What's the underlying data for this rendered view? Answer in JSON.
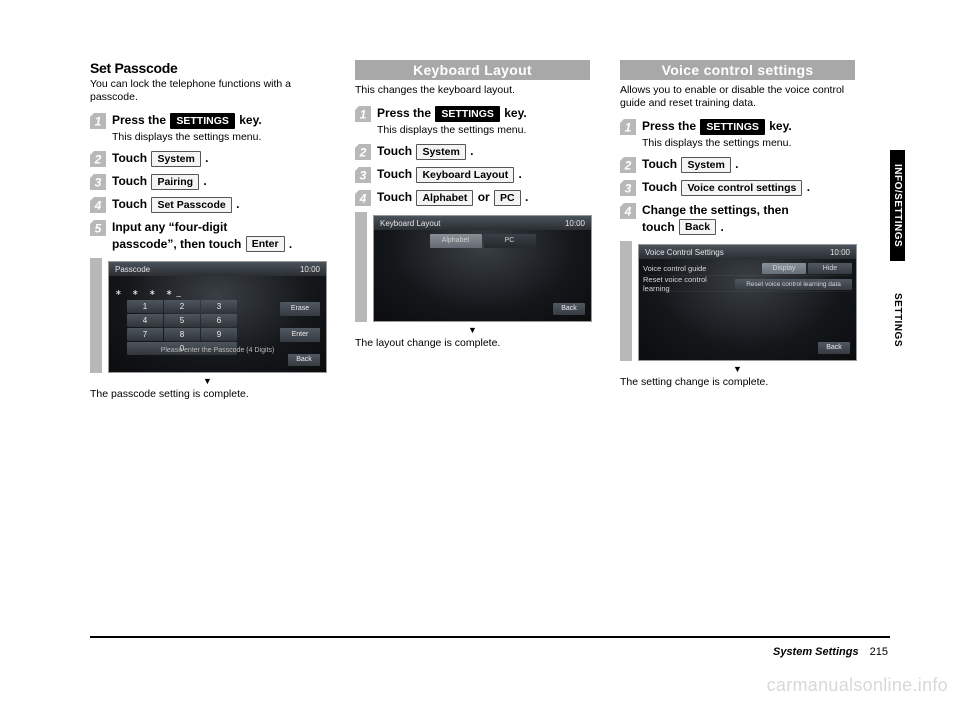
{
  "col1": {
    "title": "Set Passcode",
    "sub": "You can lock the telephone functions with a passcode.",
    "step1_pre": "Press the ",
    "settings_btn": "SETTINGS",
    "step1_post": " key.",
    "step1_note": "This displays the settings menu.",
    "step2_pre": "Touch ",
    "system_btn": "System",
    "dot": " .",
    "step3_pre": "Touch ",
    "pairing_btn": "Pairing",
    "step4_pre": "Touch ",
    "setpass_btn": "Set Passcode",
    "step5_line1": "Input any “four-digit",
    "step5_line2_pre": "passcode”, then touch ",
    "enter_btn": "Enter",
    "ss_title": "Passcode",
    "ss_clock": "10:00",
    "ss_stars": "∗ ∗ ∗ ∗_",
    "ss_erase": "Erase",
    "ss_enter": "Enter",
    "ss_back": "Back",
    "ss_keys": {
      "k1": "1",
      "k2": "2",
      "k3": "3",
      "k4": "4",
      "k5": "5",
      "k6": "6",
      "k7": "7",
      "k8": "8",
      "k9": "9",
      "k0": "0"
    },
    "ss_footer": "Please enter the Passcode (4 Digits)",
    "caret": "▼",
    "final": "The passcode setting is complete."
  },
  "col2": {
    "header": "Keyboard Layout",
    "sub": "This changes the keyboard layout.",
    "step1_pre": "Press the ",
    "settings_btn": "SETTINGS",
    "step1_post": " key.",
    "step1_note": "This displays the settings menu.",
    "step2_pre": "Touch ",
    "system_btn": "System",
    "dot": " .",
    "step3_pre": "Touch ",
    "kblayout_btn": "Keyboard Layout",
    "step4_pre": "Touch ",
    "alpha_btn": "Alphabet",
    "step4_mid": " or ",
    "pc_btn": "PC",
    "ss_title": "Keyboard Layout",
    "ss_clock": "10:00",
    "ss_alpha": "Alphabet",
    "ss_pc": "PC",
    "ss_back": "Back",
    "caret": "▼",
    "final": "The layout change is complete."
  },
  "col3": {
    "header": "Voice control settings",
    "sub": "Allows you to enable or disable the voice control guide and reset training data.",
    "step1_pre": "Press the ",
    "settings_btn": "SETTINGS",
    "step1_post": " key.",
    "step1_note": "This displays the settings menu.",
    "step2_pre": "Touch ",
    "system_btn": "System",
    "dot": " .",
    "step3_pre": "Touch ",
    "vcs_btn": "Voice control settings",
    "step4_line1": "Change the settings, then",
    "step4_line2_pre": "touch ",
    "back_btn": "Back",
    "ss_title": "Voice Control Settings",
    "ss_clock": "10:00",
    "ss_row1": "Voice control guide",
    "ss_row1_a": "Display",
    "ss_row1_b": "Hide",
    "ss_row2": "Reset voice control learning",
    "ss_row2_btn": "Reset voice control learning data",
    "ss_back": "Back",
    "caret": "▼",
    "final": "The setting change is complete."
  },
  "sidetabs": {
    "primary": "INFO/SETTINGS",
    "secondary": "SETTINGS"
  },
  "footer": {
    "section": "System Settings",
    "page": "215"
  },
  "watermark": "carmanualsonline.info"
}
